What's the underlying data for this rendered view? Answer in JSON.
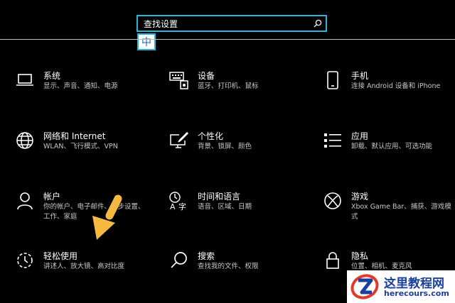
{
  "search": {
    "value": "查找设置"
  },
  "ime": {
    "label": "中"
  },
  "tiles": [
    {
      "title": "系统",
      "desc": "显示、声音、通知、电源"
    },
    {
      "title": "设备",
      "desc": "蓝牙、打印机、鼠标"
    },
    {
      "title": "手机",
      "desc": "连接 Android 设备和 iPhone"
    },
    {
      "title": "网络和 Internet",
      "desc": "WLAN、飞行模式、VPN"
    },
    {
      "title": "个性化",
      "desc": "背景、锁屏、颜色"
    },
    {
      "title": "应用",
      "desc": "卸载、默认应用、可选功能"
    },
    {
      "title": "帐户",
      "desc": "你的帐户、电子邮件、同步设置、工作、家庭"
    },
    {
      "title": "时间和语言",
      "desc": "语音、区域、日期"
    },
    {
      "title": "游戏",
      "desc": "Xbox Game Bar、捕获、游戏模式"
    },
    {
      "title": "轻松使用",
      "desc": "讲述人、放大镜、高对比度"
    },
    {
      "title": "搜索",
      "desc": "查找我的文件、权限"
    },
    {
      "title": "隐私",
      "desc": "位置、相机、麦克风"
    }
  ],
  "watermark": {
    "title": "这里教程网",
    "url": "herecours.com"
  },
  "colors": {
    "accent": "#29b6d8",
    "arrow": "#f5b942",
    "watermark_text": "#1b3f9c"
  }
}
